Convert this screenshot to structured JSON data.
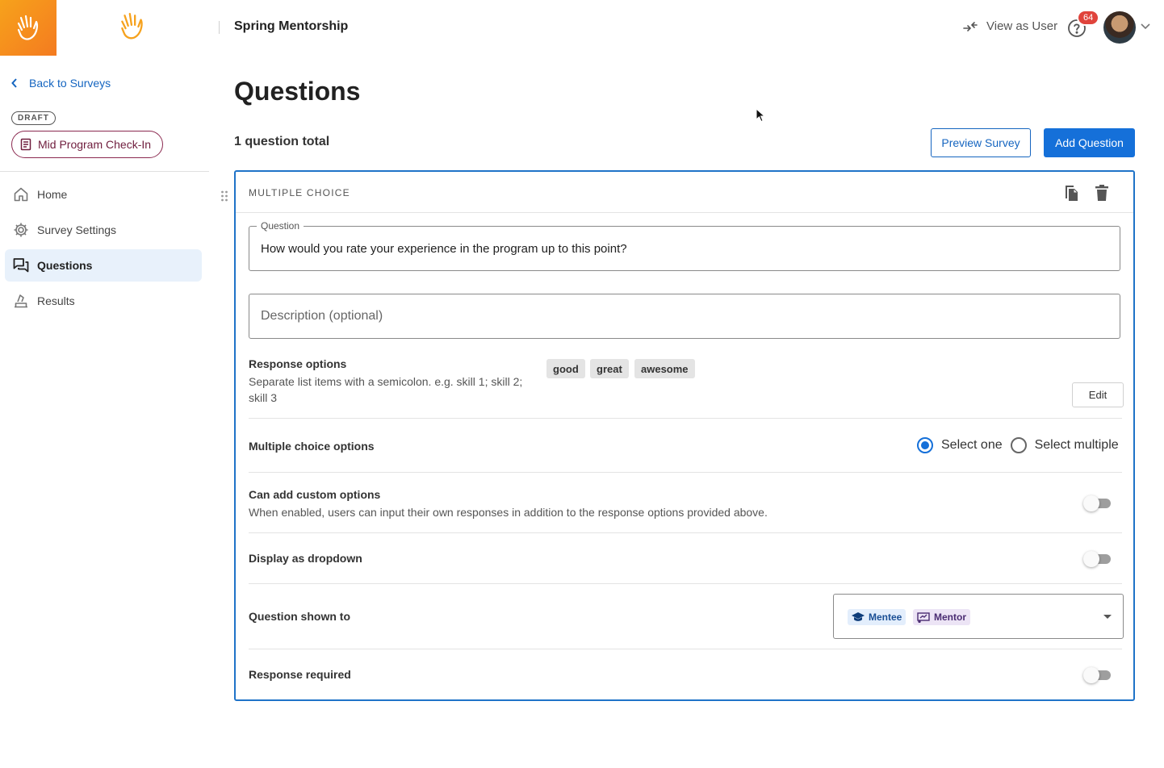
{
  "header": {
    "program_name": "Spring Mentorship",
    "view_as_user": "View as User",
    "help_badge_count": "64"
  },
  "sidebar": {
    "back_label": "Back to Surveys",
    "status_chip": "DRAFT",
    "survey_name": "Mid Program Check-In",
    "items": [
      {
        "label": "Home",
        "icon": "home-icon"
      },
      {
        "label": "Survey Settings",
        "icon": "gear-icon"
      },
      {
        "label": "Questions",
        "icon": "questions-icon",
        "active": true
      },
      {
        "label": "Results",
        "icon": "results-icon"
      }
    ]
  },
  "main": {
    "title": "Questions",
    "total": "1 question total",
    "preview_button": "Preview Survey",
    "add_button": "Add Question"
  },
  "question": {
    "type": "MULTIPLE CHOICE",
    "question_legend": "Question",
    "question_value": "How would you rate your experience in the program up to this point?",
    "description_placeholder": "Description (optional)",
    "response_options_title": "Response options",
    "response_options_hint": "Separate list items with a semicolon. e.g. skill 1; skill 2; skill 3",
    "options": [
      "good",
      "great",
      "awesome"
    ],
    "edit_button": "Edit",
    "mc_options_title": "Multiple choice options",
    "select_one": "Select one",
    "select_multiple": "Select multiple",
    "selected_mode": "Select one",
    "custom_title": "Can add custom options",
    "custom_hint": "When enabled, users can input their own responses in addition to the response options provided above.",
    "custom_enabled": false,
    "dropdown_title": "Display as dropdown",
    "dropdown_enabled": false,
    "shown_to_title": "Question shown to",
    "roles": [
      "Mentee",
      "Mentor"
    ],
    "required_title": "Response required",
    "required_enabled": false
  },
  "colors": {
    "brand_orange": "#f47b20",
    "primary_blue": "#1570d9",
    "survey_pill": "#8b2a50",
    "badge_red": "#e0443c",
    "mentee_chip_bg": "#e3eefc",
    "mentor_chip_bg": "#ece4f5"
  }
}
